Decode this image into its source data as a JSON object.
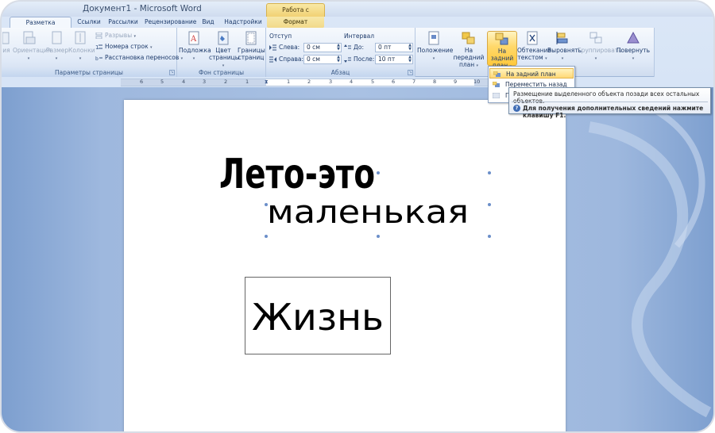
{
  "window": {
    "title": "Документ1 - Microsoft Word",
    "context_group": "Работа с надписями"
  },
  "tabs": [
    {
      "label": "Разметка страницы",
      "active": true
    },
    {
      "label": "Ссылки"
    },
    {
      "label": "Рассылки"
    },
    {
      "label": "Рецензирование"
    },
    {
      "label": "Вид"
    },
    {
      "label": "Надстройки"
    },
    {
      "label": "Формат",
      "contextual": true
    }
  ],
  "ribbon": {
    "page_setup": {
      "label": "Параметры страницы",
      "btn_cut": "ия",
      "orientation": "Ориентация",
      "size": "Размер",
      "columns": "Колонки",
      "breaks": "Разрывы",
      "line_numbers": "Номера строк",
      "hyphenation": "Расстановка переносов"
    },
    "page_background": {
      "label": "Фон страницы",
      "watermark": "Подложка",
      "page_color_1": "Цвет",
      "page_color_2": "страницы",
      "page_borders_1": "Границы",
      "page_borders_2": "страниц"
    },
    "paragraph": {
      "label": "Абзац",
      "indent_label": "Отступ",
      "spacing_label": "Интервал",
      "left_label": "Слева:",
      "left_value": "0 см",
      "right_label": "Справа:",
      "right_value": "0 см",
      "before_label": "До:",
      "before_value": "0 пт",
      "after_label": "После:",
      "after_value": "10 пт"
    },
    "arrange": {
      "position": "Положение",
      "bring_front_1": "На передний",
      "bring_front_2": "план",
      "send_back_1": "На задний",
      "send_back_2": "план",
      "wrap_1": "Обтекание",
      "wrap_2": "текстом",
      "align": "Выровнять",
      "group": "Группировать",
      "rotate": "Повернуть"
    }
  },
  "ruler": {
    "numbers_left": [
      "6",
      "5",
      "4",
      "3",
      "2",
      "1"
    ],
    "numbers_right": [
      "1",
      "2",
      "3",
      "4",
      "5",
      "6",
      "7",
      "8",
      "9",
      "10"
    ]
  },
  "dropdown": {
    "items": [
      {
        "label": "На задний план",
        "highlighted": true
      },
      {
        "label": "Переместить назад"
      },
      {
        "label": "П"
      }
    ]
  },
  "tooltip": {
    "description": "Размещение выделенного объекта позади всех остальных объектов.",
    "help": "Для получения дополнительных сведений нажмите клавишу F1."
  },
  "document": {
    "wordart_line1": "Лето-это",
    "wordart_line2": "маленькая",
    "textbox_text": "Жизнь"
  },
  "colors": {
    "accent": "#ffd86a",
    "ribbon": "#dfe9f7",
    "doc_bg": "#9eb8de"
  }
}
